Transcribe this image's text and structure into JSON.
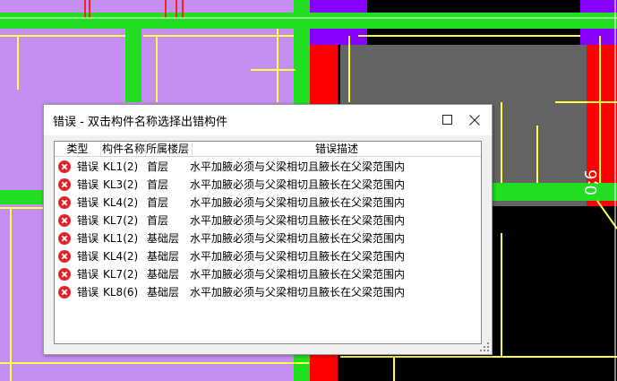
{
  "background": {
    "dim_label": "0;6"
  },
  "dialog": {
    "title": "错误 - 双击构件名称选择出错构件",
    "maximize_icon": "maximize-icon",
    "close_icon": "close-icon",
    "columns": {
      "type": "类型",
      "name": "构件名称",
      "floor": "所属楼层",
      "desc": "错误描述"
    },
    "rows": [
      {
        "type": "错误",
        "name": "KL1(2)",
        "floor": "首层",
        "desc": "水平加腋必须与父梁相切且腋长在父梁范围内"
      },
      {
        "type": "错误",
        "name": "KL3(2)",
        "floor": "首层",
        "desc": "水平加腋必须与父梁相切且腋长在父梁范围内"
      },
      {
        "type": "错误",
        "name": "KL4(2)",
        "floor": "首层",
        "desc": "水平加腋必须与父梁相切且腋长在父梁范围内"
      },
      {
        "type": "错误",
        "name": "KL7(2)",
        "floor": "首层",
        "desc": "水平加腋必须与父梁相切且腋长在父梁范围内"
      },
      {
        "type": "错误",
        "name": "KL1(2)",
        "floor": "基础层",
        "desc": "水平加腋必须与父梁相切且腋长在父梁范围内"
      },
      {
        "type": "错误",
        "name": "KL4(2)",
        "floor": "基础层",
        "desc": "水平加腋必须与父梁相切且腋长在父梁范围内"
      },
      {
        "type": "错误",
        "name": "KL7(2)",
        "floor": "基础层",
        "desc": "水平加腋必须与父梁相切且腋长在父梁范围内"
      },
      {
        "type": "错误",
        "name": "KL8(6)",
        "floor": "基础层",
        "desc": "水平加腋必须与父梁相切且腋长在父梁范围内"
      }
    ],
    "colors": {
      "error_icon": "#e0242a",
      "cad_purple_fill": "#c58ff2",
      "cad_green_beam": "#22dd22",
      "cad_red_column": "#ff0000",
      "cad_gray_slab": "#646464",
      "cad_yellow_rebar": "#ffff44",
      "cad_violet_column": "#8800ff"
    }
  }
}
